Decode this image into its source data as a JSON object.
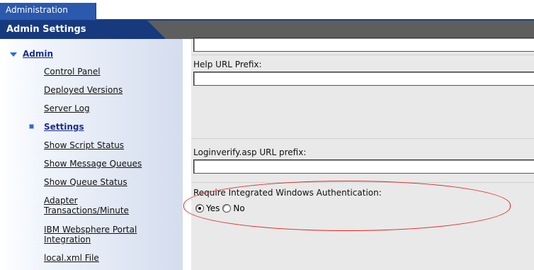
{
  "app": {
    "tab_label": "Administration",
    "section_title": "Admin Settings"
  },
  "sidebar": {
    "group_label": "Admin",
    "items": [
      {
        "label": "Control Panel"
      },
      {
        "label": "Deployed Versions"
      },
      {
        "label": "Server Log"
      },
      {
        "label": "Settings",
        "active": true
      },
      {
        "label": "Show Script Status"
      },
      {
        "label": "Show Message Queues"
      },
      {
        "label": "Show Queue Status"
      },
      {
        "label": "Adapter Transactions/Minute"
      },
      {
        "label": "IBM Websphere Portal Integration"
      },
      {
        "label": "local.xml File"
      }
    ]
  },
  "form": {
    "top_field_value": "",
    "help_url": {
      "label": "Help URL Prefix:",
      "value": ""
    },
    "loginverify_url": {
      "label": "Loginverify.asp URL prefix:",
      "value": ""
    },
    "windows_auth": {
      "label": "Require Integrated Windows Authentication:",
      "options": [
        "Yes",
        "No"
      ],
      "selected": "Yes"
    }
  },
  "colors": {
    "nav_blue": "#17397e",
    "tab_blue": "#2a59ad",
    "link_blue": "#1a2e8c",
    "highlight_red": "#e2231a"
  },
  "icons": {
    "group_toggle": "triangle-down-icon",
    "active_marker": "square-bullet-icon"
  }
}
